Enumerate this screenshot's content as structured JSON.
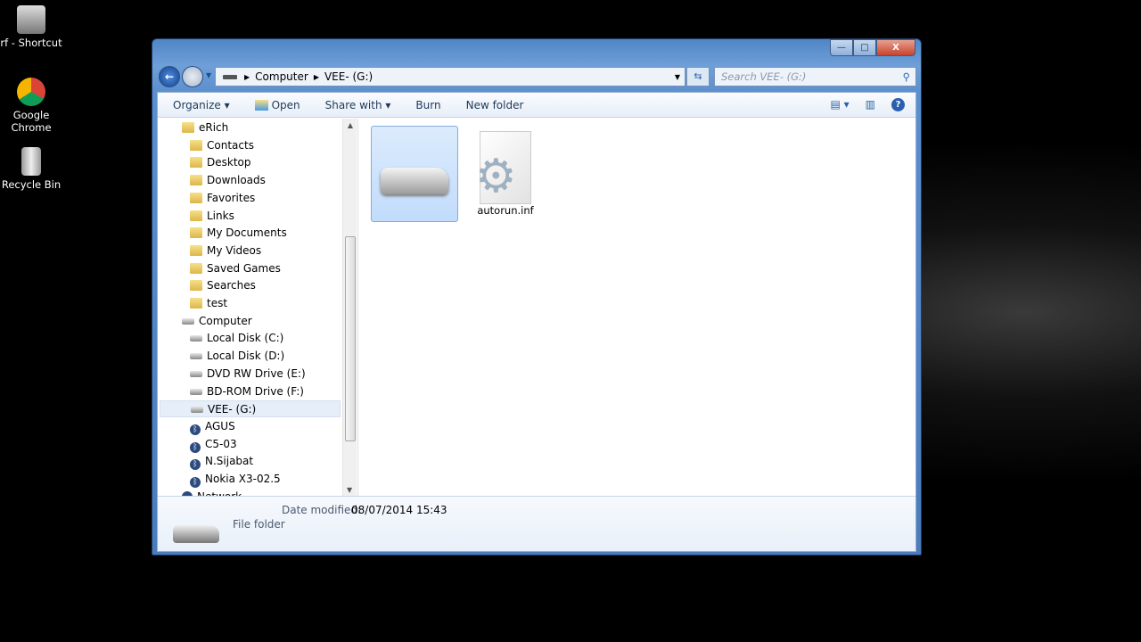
{
  "desktop": [
    {
      "label": "rf - Shortcut"
    },
    {
      "label": "Google Chrome"
    },
    {
      "label": "Recycle Bin"
    }
  ],
  "window": {
    "caption": {
      "minimize": "—",
      "maximize": "□",
      "close": "X"
    }
  },
  "address": {
    "segments": [
      "Computer",
      "VEE- (G:)"
    ]
  },
  "search": {
    "placeholder": "Search VEE- (G:)"
  },
  "toolbar": {
    "organize": "Organize ▾",
    "open": "Open",
    "share": "Share with ▾",
    "burn": "Burn",
    "new_folder": "New folder"
  },
  "nav": {
    "items": [
      {
        "label": "eRich",
        "level": 0,
        "icon": "user-folder"
      },
      {
        "label": "Contacts",
        "level": 1,
        "icon": "folder"
      },
      {
        "label": "Desktop",
        "level": 1,
        "icon": "folder"
      },
      {
        "label": "Downloads",
        "level": 1,
        "icon": "folder"
      },
      {
        "label": "Favorites",
        "level": 1,
        "icon": "folder"
      },
      {
        "label": "Links",
        "level": 1,
        "icon": "folder"
      },
      {
        "label": "My Documents",
        "level": 1,
        "icon": "folder"
      },
      {
        "label": "My Videos",
        "level": 1,
        "icon": "folder"
      },
      {
        "label": "Saved Games",
        "level": 1,
        "icon": "folder"
      },
      {
        "label": "Searches",
        "level": 1,
        "icon": "folder"
      },
      {
        "label": "test",
        "level": 1,
        "icon": "folder"
      },
      {
        "label": "Computer",
        "level": 0,
        "icon": "computer"
      },
      {
        "label": "Local Disk (C:)",
        "level": 1,
        "icon": "drive"
      },
      {
        "label": "Local Disk (D:)",
        "level": 1,
        "icon": "drive"
      },
      {
        "label": "DVD RW Drive (E:)",
        "level": 1,
        "icon": "drive"
      },
      {
        "label": "BD-ROM Drive (F:)",
        "level": 1,
        "icon": "drive"
      },
      {
        "label": "VEE- (G:)",
        "level": 1,
        "icon": "drive",
        "selected": true
      },
      {
        "label": "AGUS",
        "level": 1,
        "icon": "bluetooth"
      },
      {
        "label": "C5-03",
        "level": 1,
        "icon": "bluetooth"
      },
      {
        "label": "N.Sijabat",
        "level": 1,
        "icon": "bluetooth"
      },
      {
        "label": "Nokia X3-02.5",
        "level": 1,
        "icon": "bluetooth"
      },
      {
        "label": "Network",
        "level": 0,
        "icon": "network"
      }
    ]
  },
  "files": [
    {
      "label": "",
      "icon": "drive-folder",
      "selected": true
    },
    {
      "label": "autorun.inf",
      "icon": "settings-file"
    }
  ],
  "details": {
    "date_label": "Date modified:",
    "date_value": "08/07/2014 15:43",
    "type": "File folder"
  }
}
